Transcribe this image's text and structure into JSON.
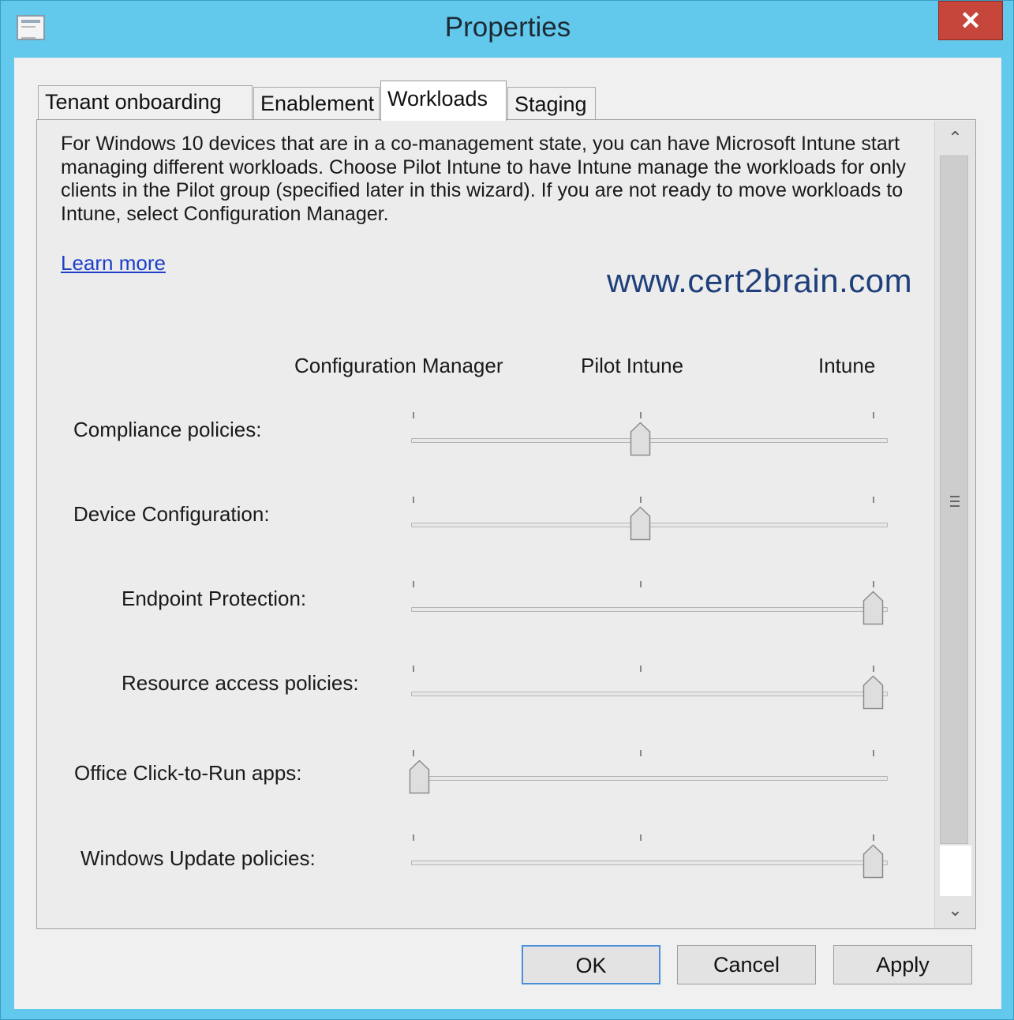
{
  "window": {
    "title": "Properties",
    "close_glyph": "✕"
  },
  "tabs": [
    {
      "label": "Tenant onboarding",
      "active": false
    },
    {
      "label": "Enablement",
      "active": false
    },
    {
      "label": "Workloads",
      "active": true
    },
    {
      "label": "Staging",
      "active": false
    }
  ],
  "workloads": {
    "description": "For Windows 10 devices that are in a co-management state, you can have Microsoft Intune start managing different workloads. Choose Pilot Intune to have Intune manage the workloads for only clients in the Pilot group (specified later in this wizard). If you are not ready to move workloads to Intune, select Configuration Manager.",
    "learn_more": "Learn more",
    "watermark": "www.cert2brain.com",
    "columns": [
      "Configuration Manager",
      "Pilot Intune",
      "Intune"
    ],
    "rows": [
      {
        "label": "Compliance policies:",
        "setting": "Pilot Intune",
        "position": 1
      },
      {
        "label": "Device Configuration:",
        "setting": "Pilot Intune",
        "position": 1
      },
      {
        "label": "Endpoint Protection:",
        "setting": "Intune",
        "position": 2
      },
      {
        "label": "Resource access policies:",
        "setting": "Intune",
        "position": 2
      },
      {
        "label": "Office Click-to-Run apps:",
        "setting": "Configuration Manager",
        "position": 0
      },
      {
        "label": "Windows Update policies:",
        "setting": "Intune",
        "position": 2
      }
    ]
  },
  "scrollbar": {
    "up_glyph": "⌃",
    "down_glyph": "⌄"
  },
  "buttons": {
    "ok": "OK",
    "cancel": "Cancel",
    "apply": "Apply"
  },
  "colors": {
    "title_bar": "#62c8ec",
    "link": "#1d3fc8",
    "watermark": "#1f3f7a",
    "close": "#c7463b"
  }
}
